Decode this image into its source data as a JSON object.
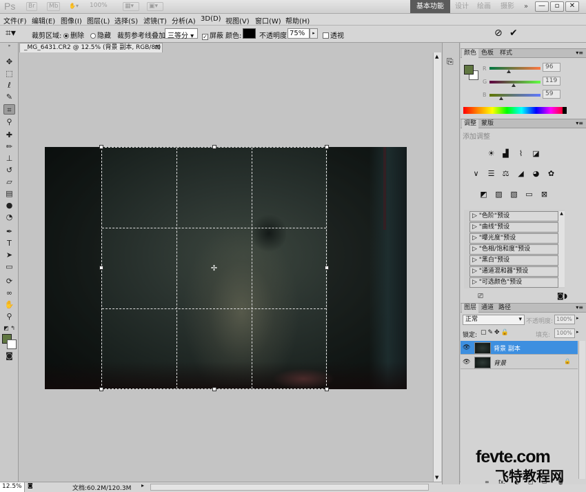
{
  "titlebar": {
    "logo": "Ps",
    "br_chip": "Br",
    "mb_chip": "Mb",
    "zoom": "100%",
    "workspaces": [
      "基本功能",
      "设计",
      "绘画",
      "摄影"
    ],
    "more": "»",
    "window_buttons": [
      "—",
      "▫",
      "✕"
    ]
  },
  "menu": [
    "文件(F)",
    "编辑(E)",
    "图像(I)",
    "图层(L)",
    "选择(S)",
    "滤镜(T)",
    "分析(A)",
    "3D(D)",
    "视图(V)",
    "窗口(W)",
    "帮助(H)"
  ],
  "options": {
    "shield_label": "裁剪区域:",
    "delete_label": "删除",
    "hide_label": "隐藏",
    "overlay_label": "裁剪参考线叠加:",
    "overlay_value": "三等分",
    "shield_check": "屏蔽",
    "color_label": "颜色:",
    "opacity_label": "不透明度:",
    "opacity_value": "75%",
    "perspective_label": "透视",
    "cancel_icon": "⊘",
    "commit_icon": "✔"
  },
  "document": {
    "tab_title": "_MG_6431.CR2 @ 12.5% (背景 副本, RGB/8*) *",
    "close": "⊠"
  },
  "status": {
    "zoom": "12.5%",
    "doc_info": "文档:60.2M/120.3M"
  },
  "color_panel": {
    "tabs": [
      "颜色",
      "色板",
      "样式"
    ],
    "channels": [
      {
        "label": "R",
        "value": "96",
        "fraction": 0.376
      },
      {
        "label": "G",
        "value": "119",
        "fraction": 0.467
      },
      {
        "label": "B",
        "value": "59",
        "fraction": 0.231
      }
    ],
    "foreground": "#607741"
  },
  "adjust_panel": {
    "tabs": [
      "调整",
      "蒙版"
    ],
    "heading": "添加调整",
    "presets": [
      "\"色阶\"预设",
      "\"曲线\"预设",
      "\"曝光度\"预设",
      "\"色相/饱和度\"预设",
      "\"黑白\"预设",
      "\"通道混和器\"预设",
      "\"可选颜色\"预设"
    ]
  },
  "layers_panel": {
    "tabs": [
      "图层",
      "通道",
      "路径"
    ],
    "blend_mode": "正常",
    "opacity_label": "不透明度:",
    "opacity_value": "100%",
    "lock_label": "锁定:",
    "fill_label": "填充:",
    "fill_value": "100%",
    "layers": [
      {
        "name": "背景 副本",
        "selected": true
      },
      {
        "name": "背景",
        "selected": false,
        "lock": "🔒"
      }
    ],
    "footer_icons": [
      "∞",
      "fx.",
      "◐",
      "▢",
      "▭",
      "🗑"
    ]
  },
  "watermark": {
    "line1": "fevte.com",
    "line2": "飞特教程网"
  }
}
